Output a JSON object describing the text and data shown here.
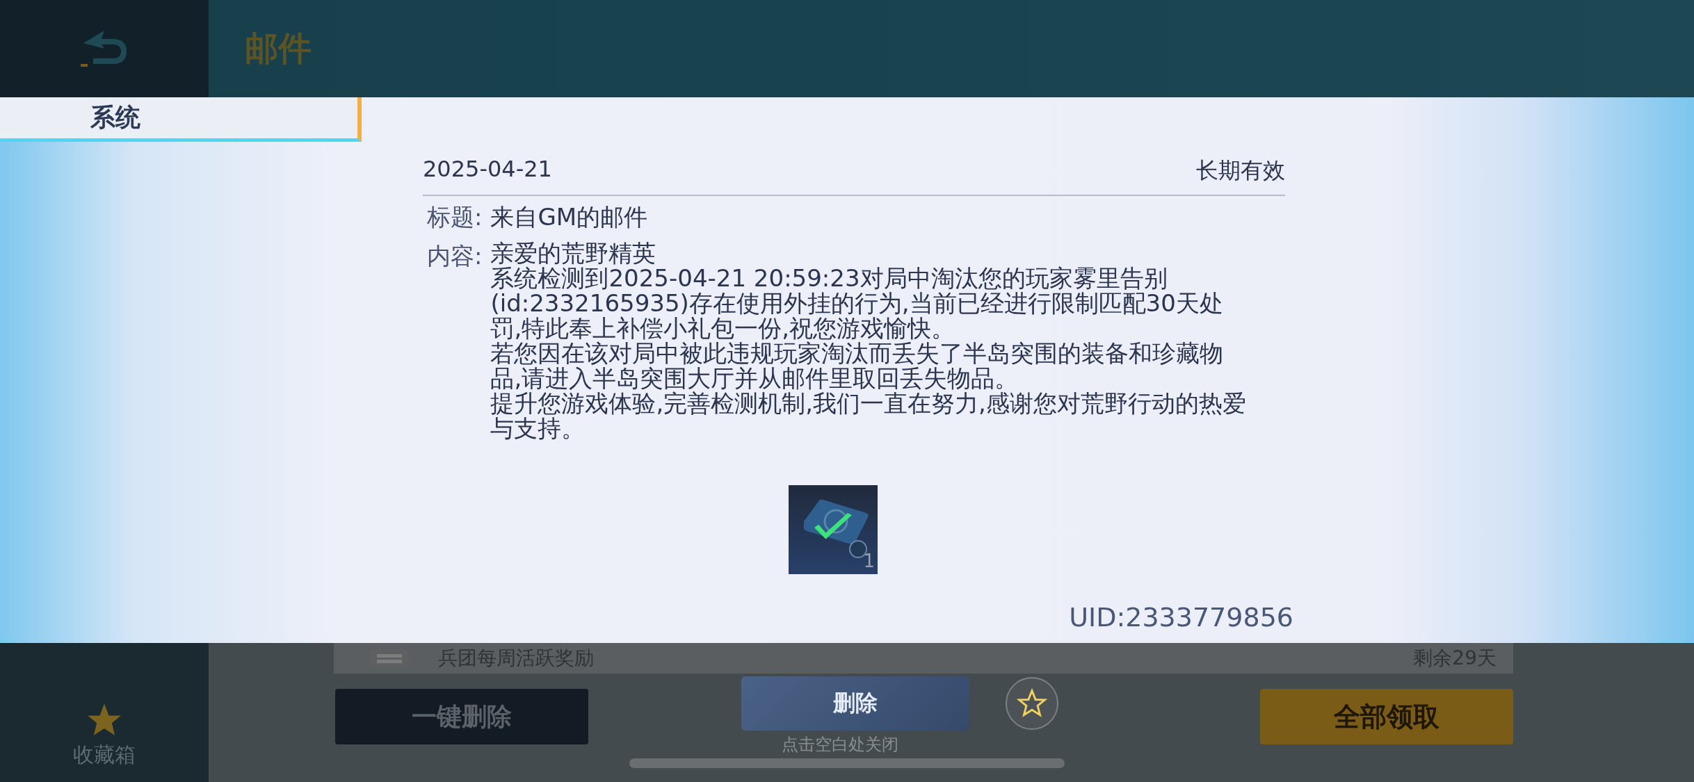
{
  "header": {
    "title": "邮件"
  },
  "tabs": [
    {
      "label": "系统",
      "selected": true
    }
  ],
  "mail": {
    "date": "2025-04-21",
    "validity": "长期有效",
    "subject_label": "标题:",
    "subject": "来自GM的邮件",
    "content_label": "内容:",
    "content_lines": [
      "亲爱的荒野精英",
      "系统检测到2025-04-21 20:59:23对局中淘汰您的玩家雾里告别",
      "(id:2332165935)存在使用外挂的行为,当前已经进行限制匹配30天处",
      "罚,特此奉上补偿小礼包一份,祝您游戏愉快。",
      "若您因在该对局中被此违规玩家淘汰而丢失了半岛突围的装备和珍藏物",
      "品,请进入半岛突围大厅并从邮件里取回丢失物品。",
      "提升您游戏体验,完善检测机制,我们一直在努力,感谢您对荒野行动的热爱",
      "与支持。"
    ],
    "attachments": [
      {
        "count": "1",
        "claimed": true
      }
    ],
    "uid": "UID:2333779856"
  },
  "background_row": {
    "title": "兵团每周活跃奖励",
    "remaining": "剩余29天"
  },
  "sidebar": {
    "favorites_label": "收藏箱"
  },
  "buttons": {
    "delete_all": "一键删除",
    "delete": "删除",
    "claim_all": "全部领取"
  },
  "close_hint": "点击空白处关闭"
}
